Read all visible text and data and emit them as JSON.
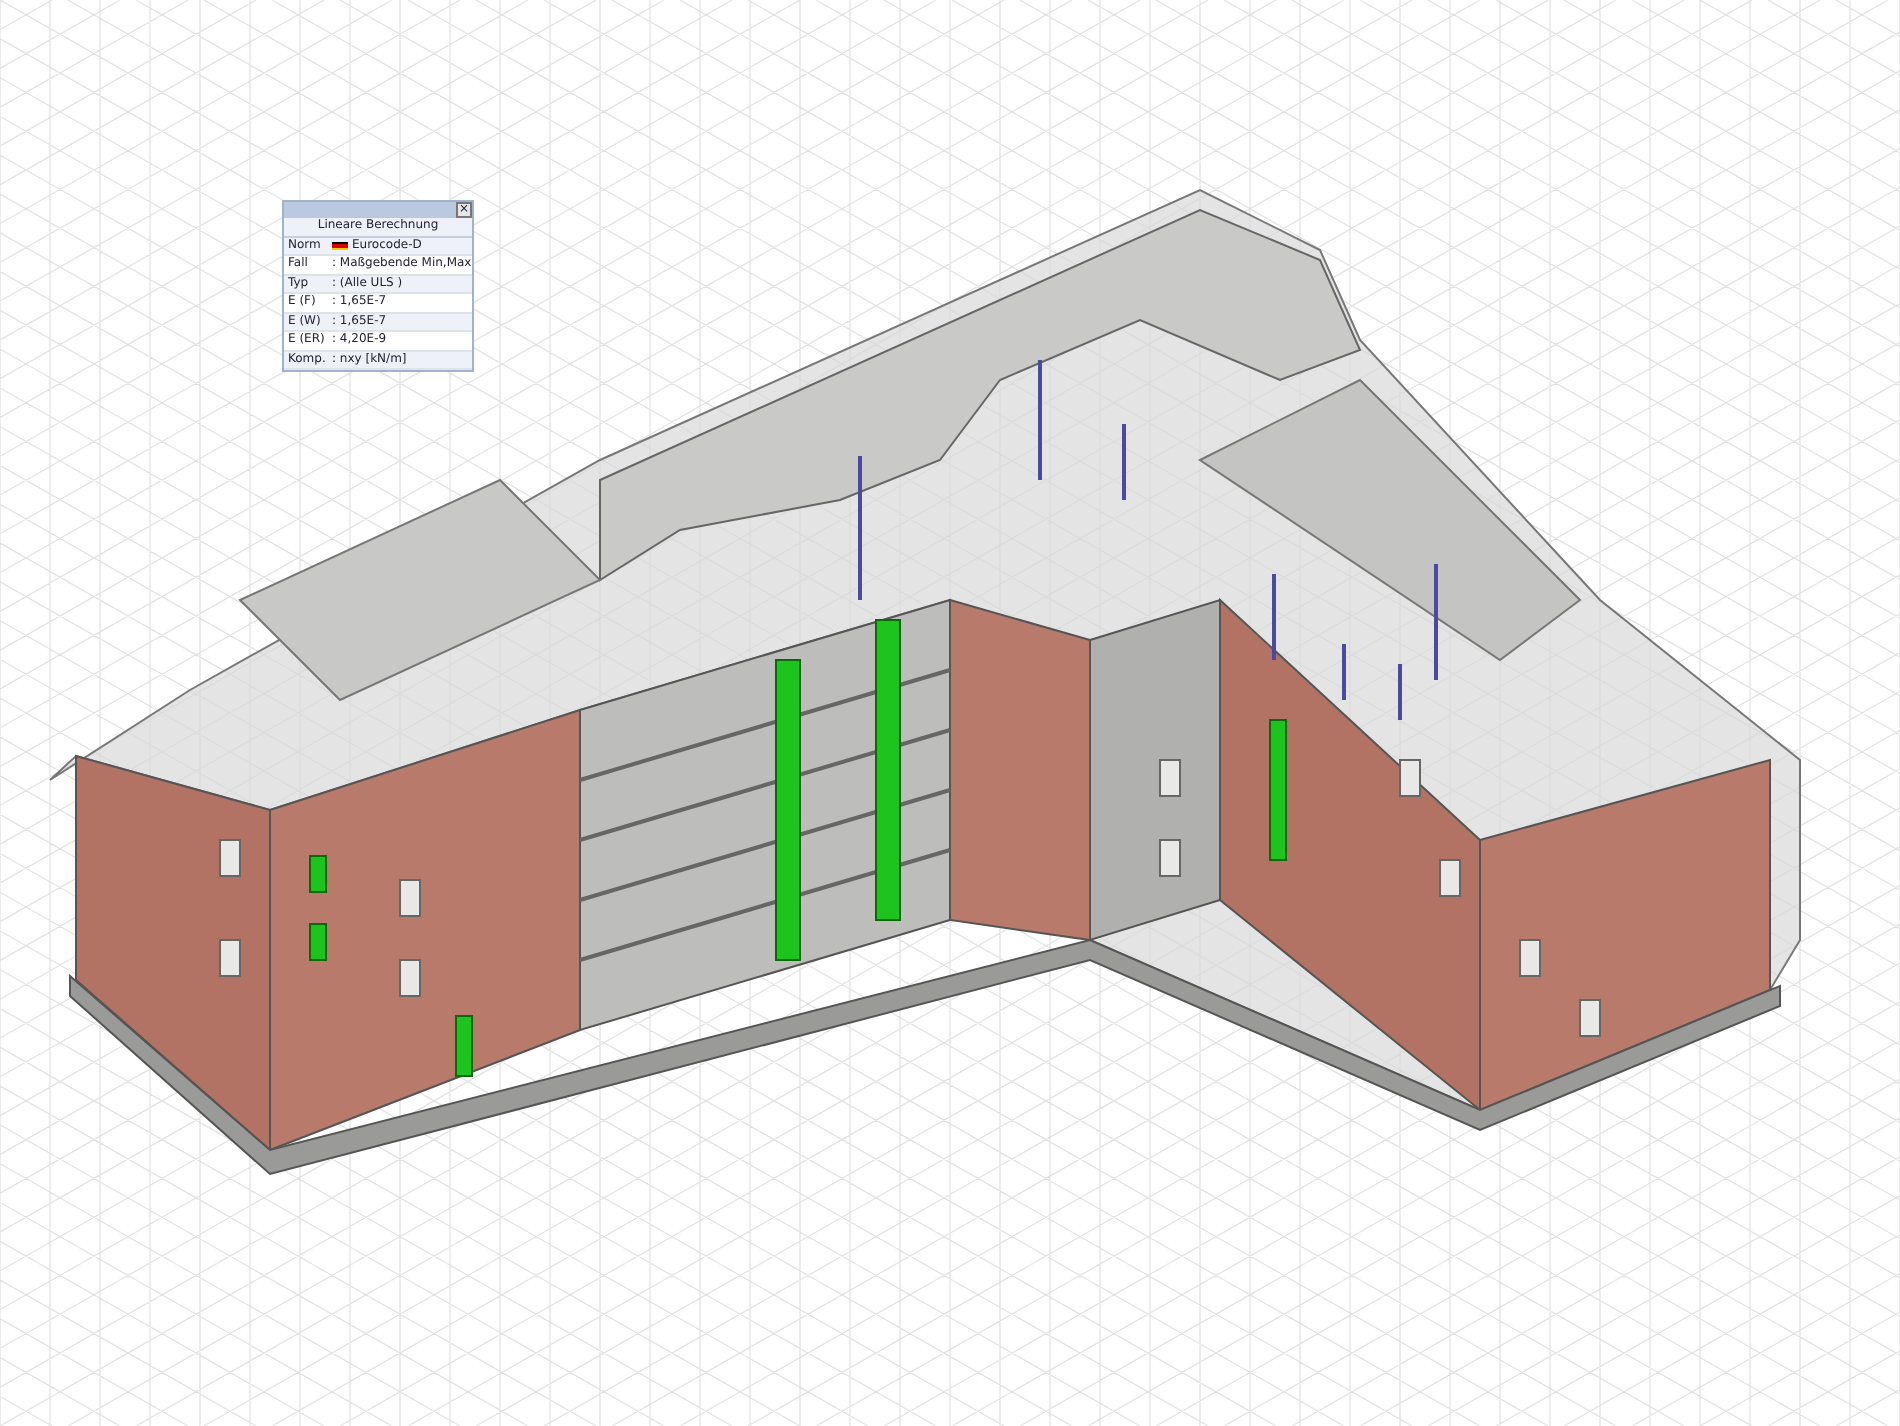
{
  "info_panel": {
    "close": "×",
    "title": "Lineare Berechnung",
    "rows": [
      {
        "label": "Norm",
        "value": "Eurocode-D",
        "flag": true
      },
      {
        "label": "Fall",
        "value": ": Maßgebende Min,Max"
      },
      {
        "label": "Typ",
        "value": ": (Alle ULS )"
      },
      {
        "label": "E (F)",
        "value": ": 1,65E-7"
      },
      {
        "label": "E (W)",
        "value": ": 1,65E-7"
      },
      {
        "label": "E (ER)",
        "value": ": 4,20E-9"
      },
      {
        "label": "Komp.",
        "value": ": nxy [kN/m]"
      }
    ]
  }
}
